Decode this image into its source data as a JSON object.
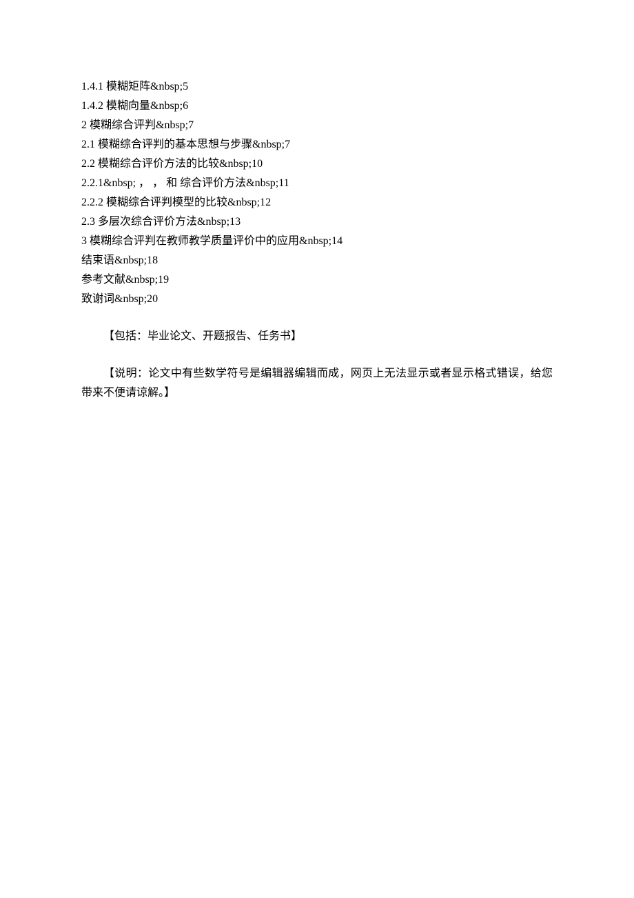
{
  "toc": {
    "items": [
      "1.4.1  模糊矩阵&nbsp;5",
      "1.4.2  模糊向量&nbsp;6",
      "2  模糊综合评判&nbsp;7",
      "2.1 模糊综合评判的基本思想与步骤&nbsp;7",
      "2.2 模糊综合评价方法的比较&nbsp;10",
      "2.2.1&nbsp;  ，  ，  和  综合评价方法&nbsp;11",
      "2.2.2 模糊综合评判模型的比较&nbsp;12",
      "2.3 多层次综合评价方法&nbsp;13",
      "3  模糊综合评判在教师教学质量评价中的应用&nbsp;14",
      "结束语&nbsp;18",
      "参考文献&nbsp;19",
      "致谢词&nbsp;20"
    ]
  },
  "paragraphs": {
    "p1": "【包括：毕业论文、开题报告、任务书】",
    "p2": "【说明：论文中有些数学符号是编辑器编辑而成，网页上无法显示或者显示格式错误，给您带来不便请谅解。】"
  }
}
